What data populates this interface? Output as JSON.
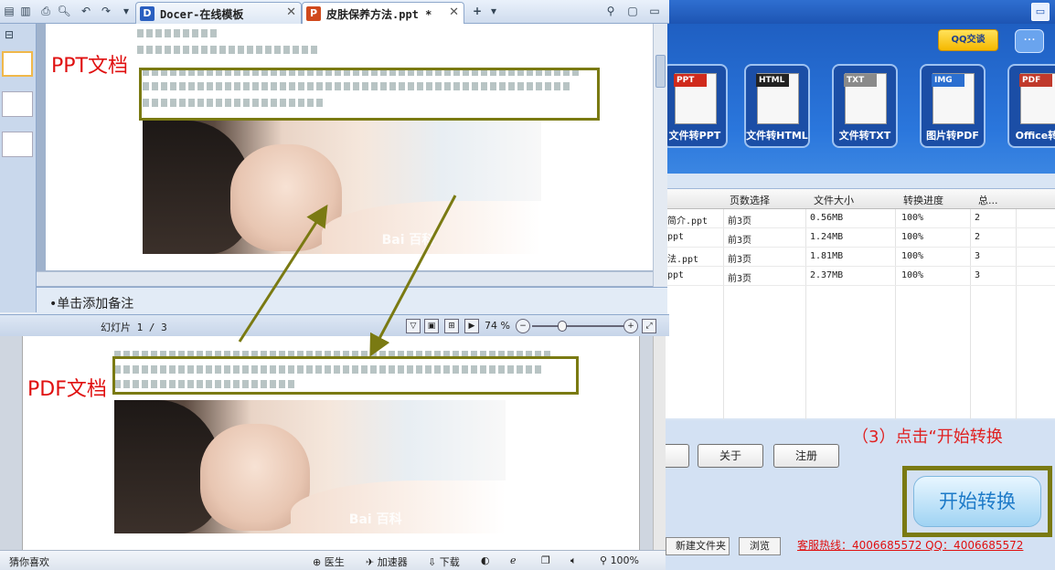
{
  "wps": {
    "tabs": [
      {
        "title": "Docer-在线模板"
      },
      {
        "title": "皮肤保养方法.ppt *"
      }
    ],
    "notes_placeholder": "•单击添加备注",
    "slide_counter": "幻灯片 1 / 3",
    "zoom": "74 %",
    "labels": {
      "ppt": "PPT文档",
      "pdf": "PDF文档"
    },
    "slide_text_line": "1、皮肤瘙痒病发的时候，如果抓挠忍处，会导致皮肤内部的神经纤维受到了严重的损伤，最后引发各种炎症，神经纤维受损即就造成了，大脑的感觉中枢出现错乱，使其发出错误的信号。",
    "watermark": "Bai 百科"
  },
  "browser_status": {
    "guess_like": "猜你喜欢",
    "doctor": "医生",
    "accelerator": "加速器",
    "download": "下载",
    "zoom": "100%"
  },
  "converter": {
    "qq_talk": "QQ交谈",
    "tools": [
      {
        "tag": "PPT",
        "label": "文件转PPT",
        "color": "#d02a1c"
      },
      {
        "tag": "HTML",
        "label": "文件转HTML",
        "color": "#222222"
      },
      {
        "tag": "TXT",
        "label": "文件转TXT",
        "color": "#8a8a8a"
      },
      {
        "tag": "IMG",
        "label": "图片转PDF",
        "color": "#2b6fd0"
      },
      {
        "tag": "PDF",
        "label": "Office转P",
        "color": "#c0392b"
      }
    ],
    "table": {
      "headers": [
        "页数选择",
        "文件大小",
        "转换进度",
        "总..."
      ],
      "rows": [
        {
          "name": "简介.ppt",
          "pages": "前3页",
          "size": "0.56MB",
          "progress": "100%",
          "total": "2"
        },
        {
          "name": "ppt",
          "pages": "前3页",
          "size": "1.24MB",
          "progress": "100%",
          "total": "2"
        },
        {
          "name": "法.ppt",
          "pages": "前3页",
          "size": "1.81MB",
          "progress": "100%",
          "total": "3"
        },
        {
          "name": "ppt",
          "pages": "前3页",
          "size": "2.37MB",
          "progress": "100%",
          "total": "3"
        }
      ]
    },
    "about_btn": "关于",
    "register_btn": "注册",
    "step_hint": "（3）点击“开始转换",
    "start_btn": "开始转换",
    "new_folder_btn": "新建文件夹",
    "browse_btn": "浏览",
    "hotline": "客服热线：4006685572 QQ：4006685572"
  }
}
